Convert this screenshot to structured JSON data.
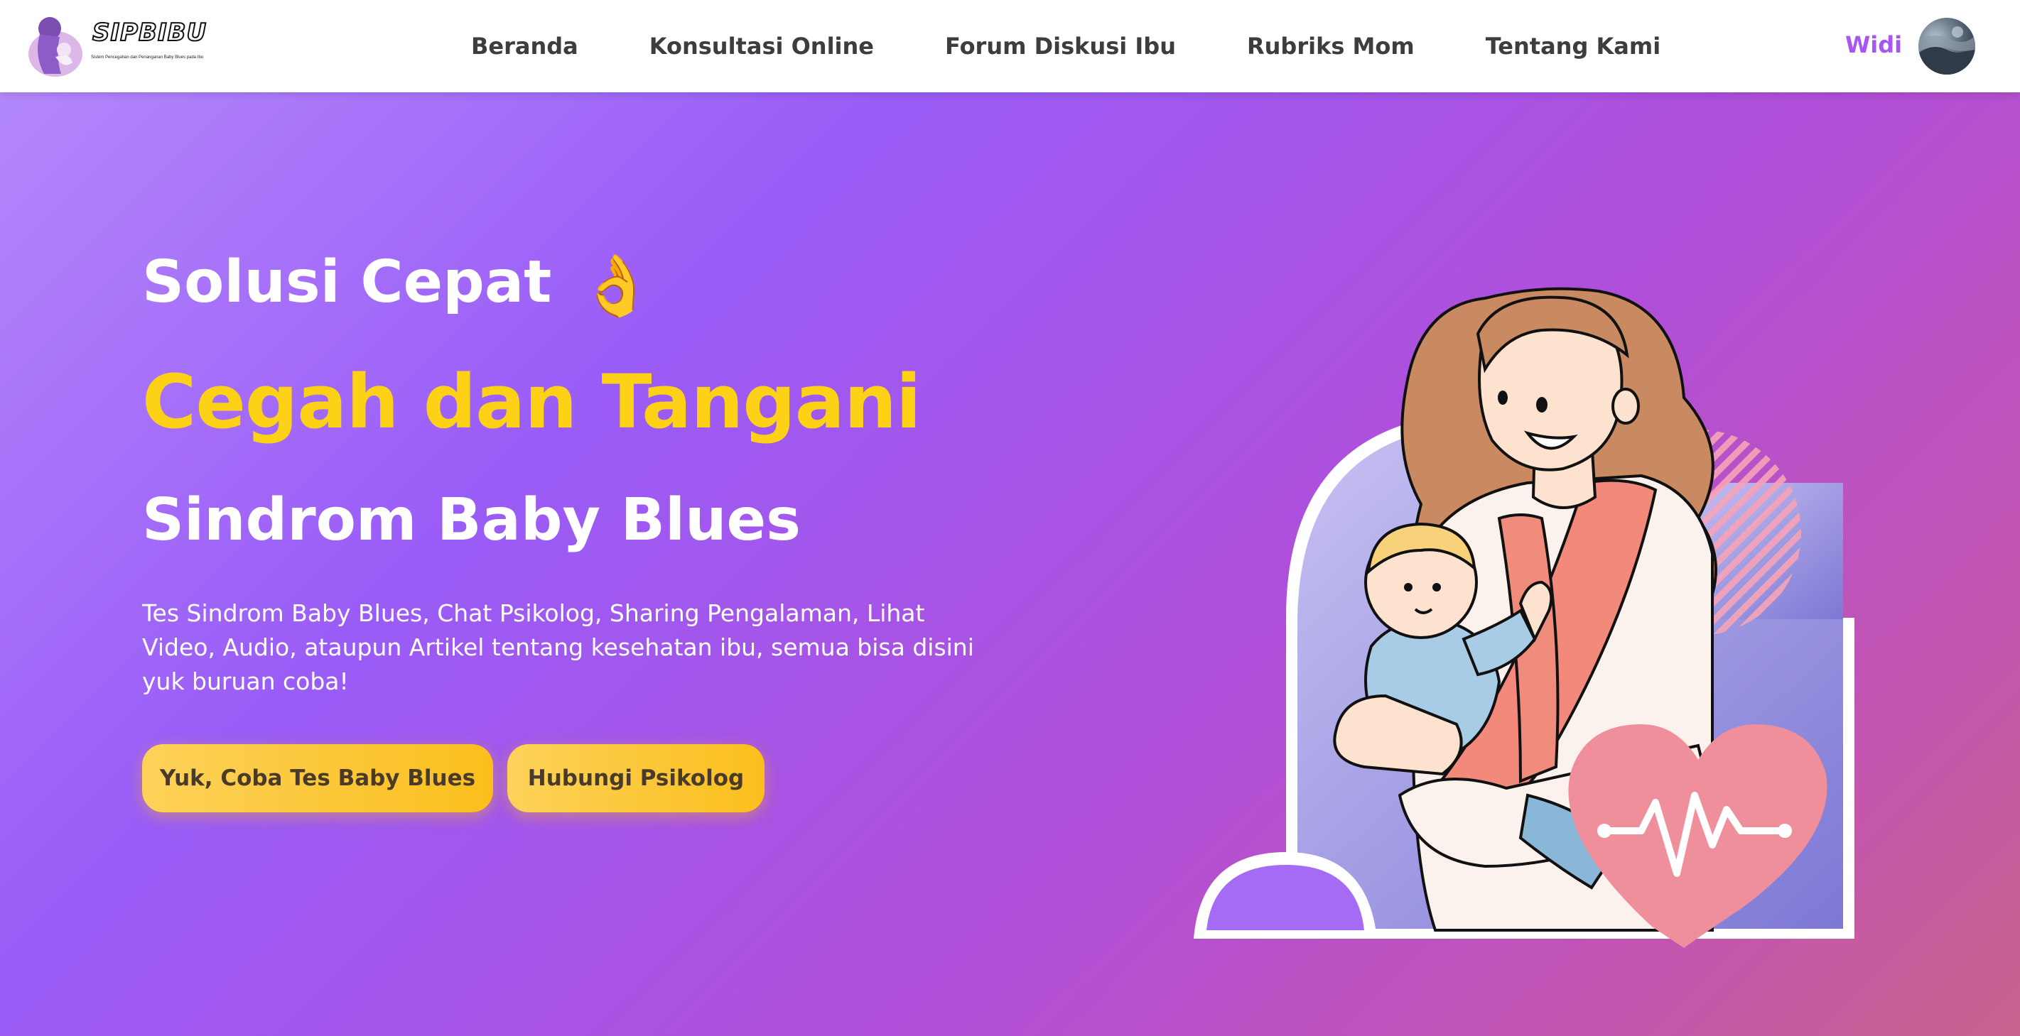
{
  "app": {
    "logo_text": "SIPBIBU",
    "logo_tagline": "Sistem Pencegahan dan Penanganan Baby Blues pada Ibu"
  },
  "nav": {
    "items": [
      {
        "label": "Beranda"
      },
      {
        "label": "Konsultasi Online"
      },
      {
        "label": "Forum Diskusi Ibu"
      },
      {
        "label": "Rubriks Mom"
      },
      {
        "label": "Tentang Kami"
      }
    ],
    "user": {
      "name": "Widi"
    }
  },
  "hero": {
    "title_line1": "Solusi Cepat",
    "title_emoji": "👌",
    "title_line2": "Cegah dan Tangani",
    "title_line3": "Sindrom Baby Blues",
    "description": "Tes Sindrom Baby Blues, Chat Psikolog, Sharing Pengalaman, Lihat Video, Audio, ataupun Artikel tentang kesehatan ibu, semua bisa disini yuk buruan coba!",
    "primary_button": "Yuk, Coba Tes Baby Blues",
    "secondary_button": "Hubungi Psikolog"
  },
  "colors": {
    "accent_purple": "#a855f7",
    "title_yellow": "#fcd116",
    "button_yellow": "#fbbf1c",
    "hero_gradient_start": "#b387fb",
    "hero_gradient_end": "#c9638d"
  },
  "icons": {
    "logo": "mother-and-baby-logo-icon",
    "emoji": "ok-hand-icon",
    "avatar": "user-avatar"
  }
}
